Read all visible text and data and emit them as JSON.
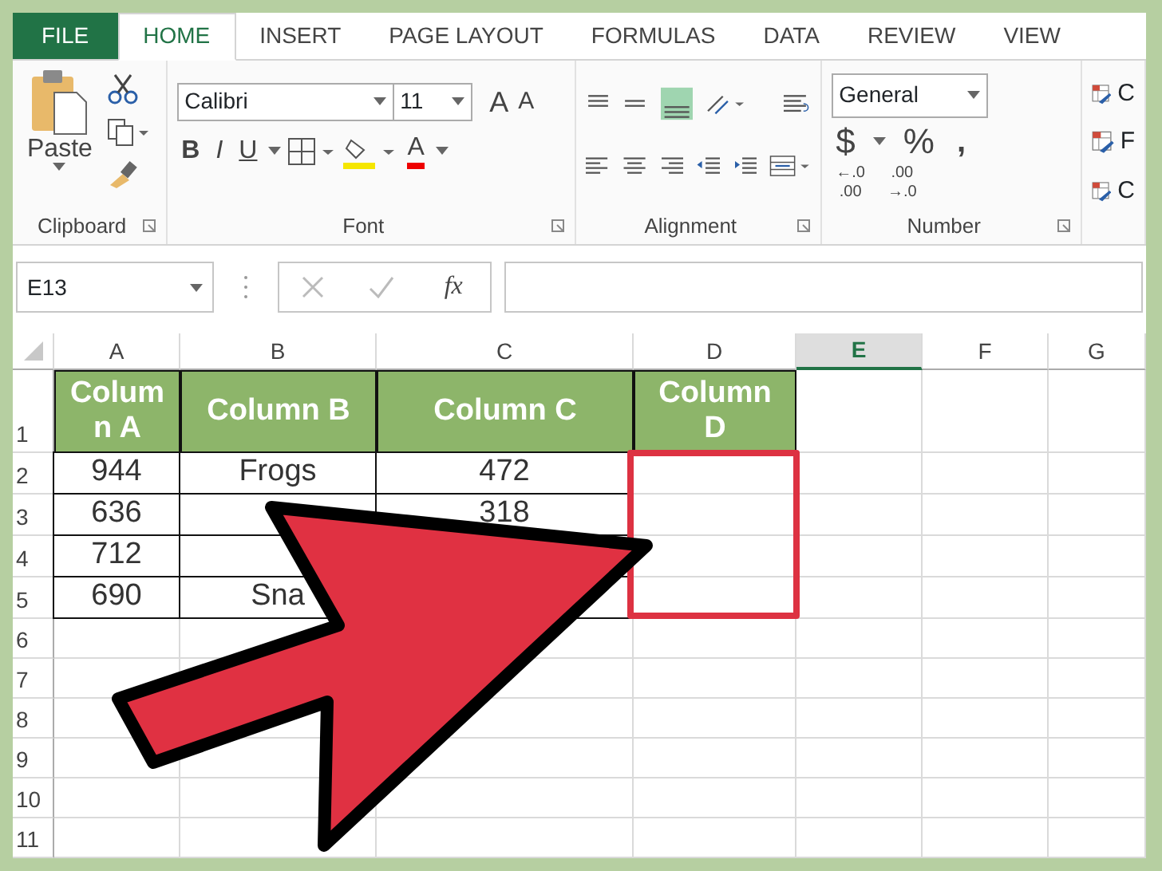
{
  "ribbon_tabs": [
    {
      "label": "FILE",
      "kind": "file",
      "selected": false
    },
    {
      "label": "HOME",
      "kind": "tab",
      "selected": true
    },
    {
      "label": "INSERT",
      "kind": "tab",
      "selected": false
    },
    {
      "label": "PAGE LAYOUT",
      "kind": "tab",
      "selected": false
    },
    {
      "label": "FORMULAS",
      "kind": "tab",
      "selected": false
    },
    {
      "label": "DATA",
      "kind": "tab",
      "selected": false
    },
    {
      "label": "REVIEW",
      "kind": "tab",
      "selected": false
    },
    {
      "label": "VIEW",
      "kind": "tab",
      "selected": false
    }
  ],
  "clipboard": {
    "paste_label": "Paste",
    "group_label": "Clipboard"
  },
  "font": {
    "font_name": "Calibri",
    "font_size": "11",
    "grow": "A",
    "shrink": "A",
    "bold": "B",
    "italic": "I",
    "underline": "U",
    "font_color": "A",
    "group_label": "Font"
  },
  "alignment": {
    "group_label": "Alignment"
  },
  "number": {
    "format": "General",
    "currency": "$",
    "percent": "%",
    "comma": ",",
    "decimals": [
      {
        "lines": [
          "←.0",
          ".00"
        ]
      },
      {
        "lines": [
          ".00",
          "→.0"
        ]
      }
    ],
    "group_label": "Number"
  },
  "styles": {
    "letters": [
      "C",
      "F",
      "C"
    ]
  },
  "formula_bar": {
    "name_box": "E13",
    "fx": "fx"
  },
  "columns": [
    {
      "label": "A",
      "selected": false
    },
    {
      "label": "B",
      "selected": false
    },
    {
      "label": "C",
      "selected": false
    },
    {
      "label": "D",
      "selected": false
    },
    {
      "label": "E",
      "selected": true
    },
    {
      "label": "F",
      "selected": false
    },
    {
      "label": "G",
      "selected": false
    }
  ],
  "rows": [
    {
      "number": "1",
      "kind": "header",
      "cells": [
        "Column A",
        "Column B",
        "Column C",
        "Column D"
      ]
    },
    {
      "number": "2",
      "kind": "data",
      "cells": [
        "944",
        "Frogs",
        "472"
      ]
    },
    {
      "number": "3",
      "kind": "data",
      "cells": [
        "636",
        "",
        "318"
      ]
    },
    {
      "number": "4",
      "kind": "data",
      "cells": [
        "712",
        "",
        ""
      ]
    },
    {
      "number": "5",
      "kind": "data",
      "cells": [
        "690",
        "Sna",
        ""
      ]
    },
    {
      "number": "6",
      "kind": "empty",
      "cells": []
    },
    {
      "number": "7",
      "kind": "empty",
      "cells": []
    },
    {
      "number": "8",
      "kind": "empty",
      "cells": []
    },
    {
      "number": "9",
      "kind": "empty",
      "cells": []
    },
    {
      "number": "10",
      "kind": "empty",
      "cells": []
    },
    {
      "number": "11",
      "kind": "empty",
      "cells": []
    }
  ]
}
